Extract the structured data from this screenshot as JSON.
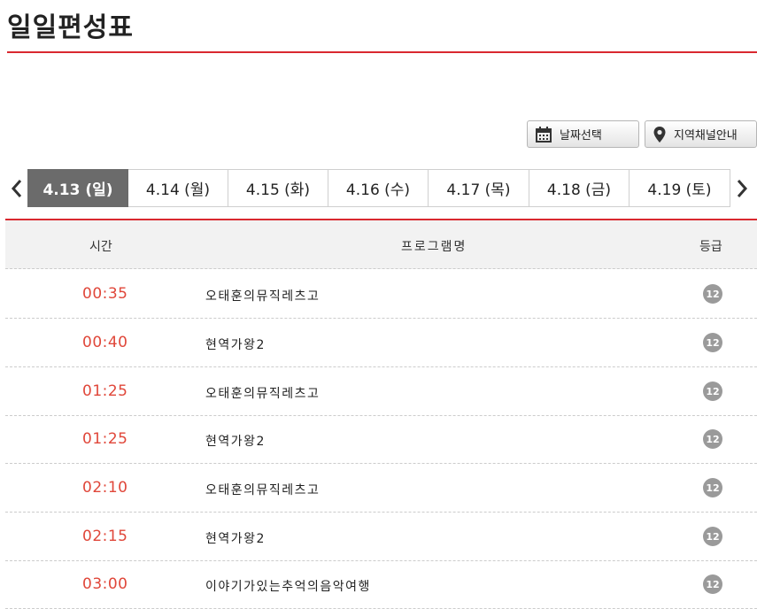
{
  "page": {
    "title": "일일편성표"
  },
  "toolbar": {
    "date_button_label": "날짜선택",
    "region_button_label": "지역채널안내"
  },
  "date_tabs": [
    {
      "label": "4.13 (일)",
      "active": true
    },
    {
      "label": "4.14 (월)",
      "active": false
    },
    {
      "label": "4.15 (화)",
      "active": false
    },
    {
      "label": "4.16 (수)",
      "active": false
    },
    {
      "label": "4.17 (목)",
      "active": false
    },
    {
      "label": "4.18 (금)",
      "active": false
    },
    {
      "label": "4.19 (토)",
      "active": false
    }
  ],
  "table": {
    "headers": {
      "time": "시간",
      "program": "프로그램명",
      "grade": "등급"
    },
    "rows": [
      {
        "time": "00:35",
        "program": "오태훈의뮤직레츠고",
        "grade": "12"
      },
      {
        "time": "00:40",
        "program": "현역가왕2",
        "grade": "12"
      },
      {
        "time": "01:25",
        "program": "오태훈의뮤직레츠고",
        "grade": "12"
      },
      {
        "time": "01:25",
        "program": "현역가왕2",
        "grade": "12"
      },
      {
        "time": "02:10",
        "program": "오태훈의뮤직레츠고",
        "grade": "12"
      },
      {
        "time": "02:15",
        "program": "현역가왕2",
        "grade": "12"
      },
      {
        "time": "03:00",
        "program": "이야기가있는추억의음악여행",
        "grade": "12"
      }
    ]
  },
  "colors": {
    "accent": "#d9282f",
    "time_text": "#e0473a",
    "active_tab": "#6b6b6b",
    "grade_badge": "#9a9a9a"
  },
  "icons": {
    "prev": "chevron-left-icon",
    "next": "chevron-right-icon",
    "calendar": "calendar-icon",
    "location": "map-pin-icon"
  }
}
